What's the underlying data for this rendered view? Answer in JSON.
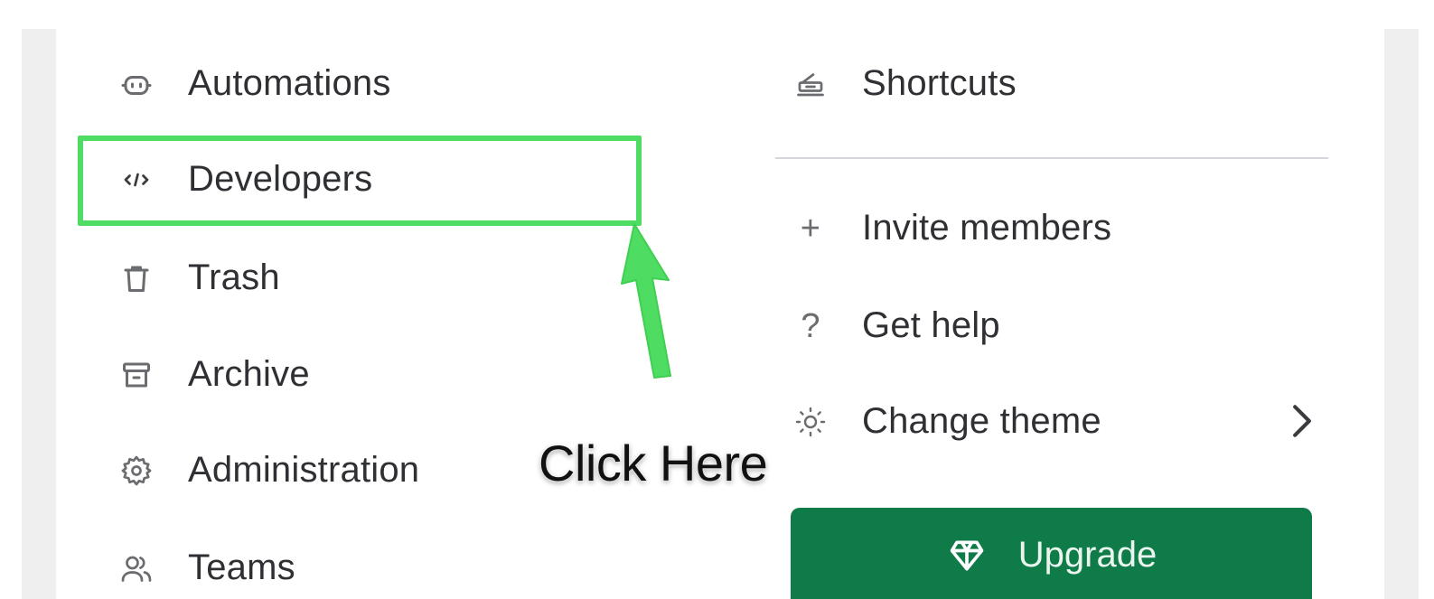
{
  "left_menu": {
    "items": [
      {
        "label": "Automations",
        "icon": "robot-icon"
      },
      {
        "label": "Developers",
        "icon": "code-icon"
      },
      {
        "label": "Trash",
        "icon": "trash-icon"
      },
      {
        "label": "Archive",
        "icon": "archive-icon"
      },
      {
        "label": "Administration",
        "icon": "gear-icon"
      },
      {
        "label": "Teams",
        "icon": "users-icon"
      }
    ]
  },
  "right_menu": {
    "items": [
      {
        "label": "Shortcuts",
        "icon": "keyboard-icon"
      },
      {
        "label": "Invite members",
        "icon": "plus-icon",
        "glyph": "+"
      },
      {
        "label": "Get help",
        "icon": "help-icon",
        "glyph": "?"
      },
      {
        "label": "Change theme",
        "icon": "sun-icon"
      }
    ]
  },
  "upgrade_button": {
    "label": "Upgrade",
    "icon": "diamond-icon"
  },
  "annotation": {
    "callout_text": "Click Here",
    "highlight_color": "#4fdc62"
  },
  "colors": {
    "upgrade_bg": "#0f7b49",
    "text": "#2f3033",
    "icon": "#6b6c70"
  }
}
